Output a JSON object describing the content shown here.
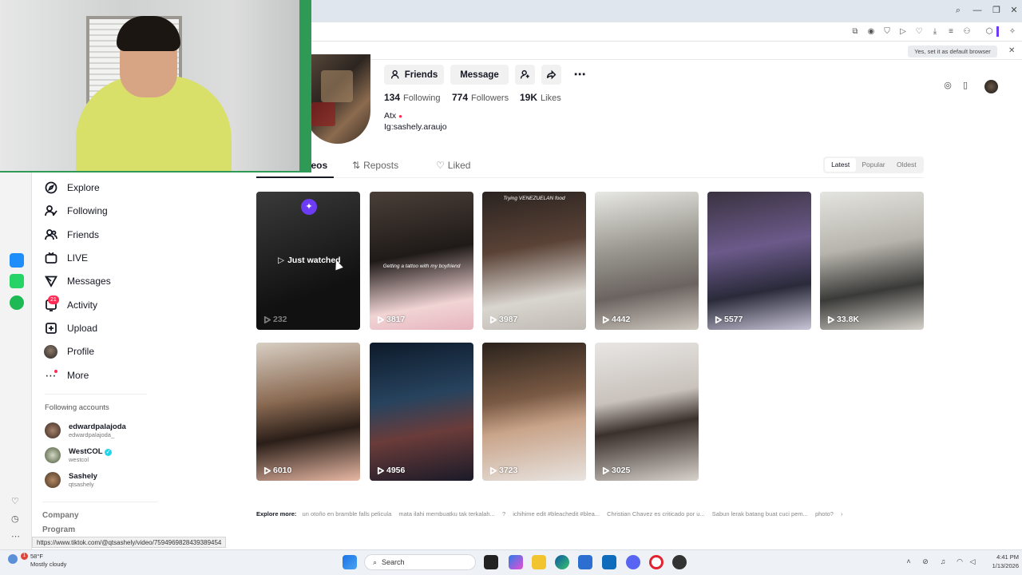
{
  "browser": {
    "default_browser_prompt": "Yes, set it as default browser"
  },
  "profile": {
    "buttons": {
      "friends": "Friends",
      "message": "Message"
    },
    "stats": [
      {
        "value": "134",
        "label": "Following"
      },
      {
        "value": "774",
        "label": "Followers"
      },
      {
        "value": "19K",
        "label": "Likes"
      }
    ],
    "bio_line1": "Atx",
    "bio_line2": "Ig:sashely.araujo"
  },
  "tabs": {
    "videos": "Videos",
    "reposts": "Reposts",
    "liked": "Liked"
  },
  "sort": {
    "latest": "Latest",
    "popular": "Popular",
    "oldest": "Oldest"
  },
  "nav": [
    {
      "label": "Explore",
      "icon": "compass-icon"
    },
    {
      "label": "Following",
      "icon": "user-check-icon"
    },
    {
      "label": "Friends",
      "icon": "users-icon"
    },
    {
      "label": "LIVE",
      "icon": "live-tv-icon"
    },
    {
      "label": "Messages",
      "icon": "send-icon"
    },
    {
      "label": "Activity",
      "icon": "bell-icon",
      "badge": "21"
    },
    {
      "label": "Upload",
      "icon": "plus-square-icon"
    },
    {
      "label": "Profile",
      "icon": "profile-avatar"
    },
    {
      "label": "More",
      "icon": "more-dots-icon"
    }
  ],
  "following_accounts": {
    "heading": "Following accounts",
    "accounts": [
      {
        "name": "edwardpalajoda",
        "handle": "edwardpalajoda_"
      },
      {
        "name": "WestCOL",
        "handle": "westcol",
        "verified": true
      },
      {
        "name": "Sashely",
        "handle": "qtsashely"
      }
    ]
  },
  "footer_links": [
    "Company",
    "Program"
  ],
  "status_url": "https://www.tiktok.com/@qtsashely/video/7594969828439389454",
  "videos": [
    {
      "views": "232",
      "overlay": "Just watched",
      "caption": ""
    },
    {
      "views": "3817",
      "caption": "Getting a tattoo with my boyfriend"
    },
    {
      "views": "3987",
      "caption": "Trying VENEZUELAN food"
    },
    {
      "views": "4442",
      "caption": ""
    },
    {
      "views": "5577",
      "caption": ""
    },
    {
      "views": "33.8K",
      "caption": ""
    },
    {
      "views": "6010",
      "caption": ""
    },
    {
      "views": "4956",
      "caption": ""
    },
    {
      "views": "3723",
      "caption": ""
    },
    {
      "views": "3025",
      "caption": ""
    }
  ],
  "explore_more": {
    "label": "Explore more:",
    "chips": [
      "un otoño en bramble falls pelicula",
      "mata ilahi membuatku tak terkalah...",
      "?",
      "ichihime edit #bleachedit #blea...",
      "Christian Chavez es criticado por u...",
      "Sabun lerak batang buat cuci pem...",
      "photo?"
    ]
  },
  "taskbar": {
    "weather_temp": "58°F",
    "weather_desc": "Mostly cloudy",
    "search": "Search",
    "time": "4:41 PM",
    "date": "1/13/2026"
  },
  "colors": {
    "accent": "#fe2c55",
    "sparkle": "#6c3cf5",
    "text": "#161823"
  }
}
